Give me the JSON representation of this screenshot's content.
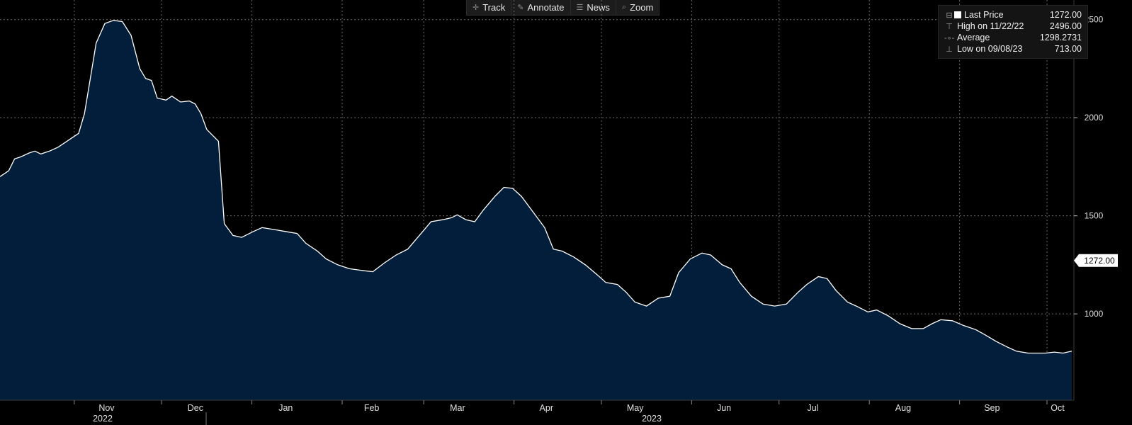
{
  "toolbar": {
    "items": [
      {
        "label": "Track",
        "icon": "crosshair-icon"
      },
      {
        "label": "Annotate",
        "icon": "pencil-icon"
      },
      {
        "label": "News",
        "icon": "news-icon"
      },
      {
        "label": "Zoom",
        "icon": "magnifier-icon"
      }
    ]
  },
  "legend": {
    "rows": [
      {
        "label": "Last Price",
        "value": "1272.00"
      },
      {
        "label": "High on 11/22/22",
        "value": "2496.00"
      },
      {
        "label": "Average",
        "value": "1298.2731"
      },
      {
        "label": "Low on 09/08/23",
        "value": "713.00"
      }
    ]
  },
  "last_price_tag": "1272.00",
  "colors": {
    "fill": "#031e3a",
    "line": "#ffffff",
    "grid": "#6a6a6a",
    "background": "#000000"
  },
  "chart_data": {
    "type": "area",
    "title": "",
    "xlabel": "",
    "ylabel": "",
    "ylim": [
      560,
      2600
    ],
    "y_ticks": [
      1000,
      1500,
      2000,
      2500
    ],
    "x_tick_labels": [
      "Nov",
      "Dec",
      "Jan",
      "Feb",
      "Mar",
      "Apr",
      "May",
      "Jun",
      "Jul",
      "Aug",
      "Sep",
      "Oct"
    ],
    "year_labels": [
      "2022",
      "2023"
    ],
    "x_range": [
      "2022-10-07",
      "2023-10-10"
    ],
    "grid": true,
    "series": [
      {
        "values": [
          [
            "2022-10-07",
            1700
          ],
          [
            "2022-10-10",
            1730
          ],
          [
            "2022-10-12",
            1790
          ],
          [
            "2022-10-14",
            1800
          ],
          [
            "2022-10-17",
            1820
          ],
          [
            "2022-10-19",
            1830
          ],
          [
            "2022-10-21",
            1815
          ],
          [
            "2022-10-24",
            1830
          ],
          [
            "2022-10-27",
            1850
          ],
          [
            "2022-10-31",
            1890
          ],
          [
            "2022-11-03",
            1920
          ],
          [
            "2022-11-05",
            2020
          ],
          [
            "2022-11-07",
            2200
          ],
          [
            "2022-11-09",
            2380
          ],
          [
            "2022-11-12",
            2480
          ],
          [
            "2022-11-15",
            2496
          ],
          [
            "2022-11-18",
            2490
          ],
          [
            "2022-11-21",
            2420
          ],
          [
            "2022-11-24",
            2250
          ],
          [
            "2022-11-26",
            2200
          ],
          [
            "2022-11-28",
            2190
          ],
          [
            "2022-11-30",
            2100
          ],
          [
            "2022-12-03",
            2090
          ],
          [
            "2022-12-05",
            2110
          ],
          [
            "2022-12-08",
            2080
          ],
          [
            "2022-12-11",
            2085
          ],
          [
            "2022-12-13",
            2070
          ],
          [
            "2022-12-15",
            2020
          ],
          [
            "2022-12-17",
            1940
          ],
          [
            "2022-12-21",
            1880
          ],
          [
            "2022-12-23",
            1460
          ],
          [
            "2022-12-26",
            1400
          ],
          [
            "2022-12-29",
            1390
          ],
          [
            "2023-01-02",
            1420
          ],
          [
            "2023-01-05",
            1440
          ],
          [
            "2023-01-09",
            1430
          ],
          [
            "2023-01-13",
            1420
          ],
          [
            "2023-01-17",
            1410
          ],
          [
            "2023-01-20",
            1360
          ],
          [
            "2023-01-24",
            1320
          ],
          [
            "2023-01-27",
            1280
          ],
          [
            "2023-01-31",
            1250
          ],
          [
            "2023-02-04",
            1230
          ],
          [
            "2023-02-09",
            1220
          ],
          [
            "2023-02-12",
            1215
          ],
          [
            "2023-02-16",
            1260
          ],
          [
            "2023-02-20",
            1300
          ],
          [
            "2023-02-24",
            1330
          ],
          [
            "2023-02-28",
            1400
          ],
          [
            "2023-03-04",
            1470
          ],
          [
            "2023-03-08",
            1480
          ],
          [
            "2023-03-11",
            1490
          ],
          [
            "2023-03-13",
            1505
          ],
          [
            "2023-03-16",
            1480
          ],
          [
            "2023-03-19",
            1470
          ],
          [
            "2023-03-22",
            1530
          ],
          [
            "2023-03-26",
            1600
          ],
          [
            "2023-03-29",
            1645
          ],
          [
            "2023-04-01",
            1640
          ],
          [
            "2023-04-04",
            1600
          ],
          [
            "2023-04-08",
            1520
          ],
          [
            "2023-04-12",
            1440
          ],
          [
            "2023-04-15",
            1330
          ],
          [
            "2023-04-18",
            1320
          ],
          [
            "2023-04-22",
            1290
          ],
          [
            "2023-04-26",
            1250
          ],
          [
            "2023-04-30",
            1200
          ],
          [
            "2023-05-03",
            1160
          ],
          [
            "2023-05-07",
            1150
          ],
          [
            "2023-05-10",
            1110
          ],
          [
            "2023-05-13",
            1060
          ],
          [
            "2023-05-17",
            1040
          ],
          [
            "2023-05-21",
            1080
          ],
          [
            "2023-05-25",
            1090
          ],
          [
            "2023-05-28",
            1210
          ],
          [
            "2023-06-01",
            1280
          ],
          [
            "2023-06-05",
            1310
          ],
          [
            "2023-06-08",
            1300
          ],
          [
            "2023-06-12",
            1250
          ],
          [
            "2023-06-15",
            1230
          ],
          [
            "2023-06-18",
            1160
          ],
          [
            "2023-06-22",
            1090
          ],
          [
            "2023-06-26",
            1050
          ],
          [
            "2023-06-30",
            1040
          ],
          [
            "2023-07-04",
            1050
          ],
          [
            "2023-07-08",
            1110
          ],
          [
            "2023-07-11",
            1150
          ],
          [
            "2023-07-15",
            1190
          ],
          [
            "2023-07-18",
            1180
          ],
          [
            "2023-07-21",
            1120
          ],
          [
            "2023-07-25",
            1060
          ],
          [
            "2023-07-28",
            1040
          ],
          [
            "2023-08-01",
            1010
          ],
          [
            "2023-08-04",
            1020
          ],
          [
            "2023-08-08",
            990
          ],
          [
            "2023-08-12",
            950
          ],
          [
            "2023-08-16",
            925
          ],
          [
            "2023-08-20",
            925
          ],
          [
            "2023-08-23",
            950
          ],
          [
            "2023-08-26",
            970
          ],
          [
            "2023-08-30",
            965
          ],
          [
            "2023-09-03",
            940
          ],
          [
            "2023-09-07",
            920
          ],
          [
            "2023-09-10",
            895
          ],
          [
            "2023-09-14",
            860
          ],
          [
            "2023-09-18",
            830
          ],
          [
            "2023-09-21",
            810
          ],
          [
            "2023-09-25",
            800
          ],
          [
            "2023-09-28",
            800
          ],
          [
            "2023-10-01",
            800
          ],
          [
            "2023-10-04",
            805
          ],
          [
            "2023-10-07",
            800
          ],
          [
            "2023-10-10",
            810
          ]
        ]
      }
    ]
  }
}
